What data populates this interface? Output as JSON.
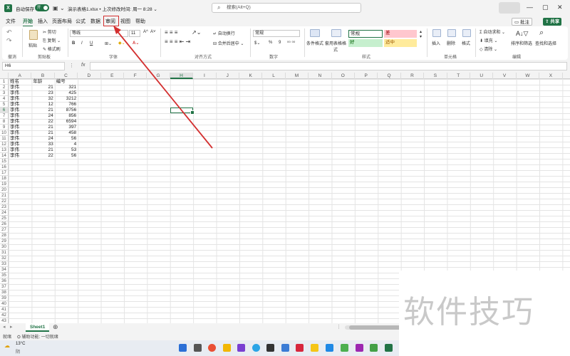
{
  "titlebar": {
    "autosave_label": "自动保存",
    "autosave_state": "开",
    "doc_title": "演示表格1.xlsx • 上次修改时间: 周一 8:28 ⌄",
    "search_placeholder": "搜索(Alt+Q)"
  },
  "menu": {
    "tabs": [
      "文件",
      "开始",
      "插入",
      "页面布局",
      "公式",
      "数据",
      "审阅",
      "视图",
      "帮助"
    ],
    "comment_btn": "批注",
    "share_btn": "共享"
  },
  "ribbon": {
    "undo": "撤消",
    "clipboard": {
      "paste": "粘贴",
      "cut": "剪切",
      "copy": "复制 ⌄",
      "format_painter": "格式刷",
      "label": "剪贴板"
    },
    "font": {
      "name": "等线",
      "size": "11",
      "grow": "A^",
      "shrink": "A˅",
      "bold": "B",
      "italic": "I",
      "underline": "U",
      "label": "字体"
    },
    "alignment": {
      "wrap": "自动换行",
      "merge": "合并后居中 ⌄",
      "label": "对齐方式"
    },
    "number": {
      "format": "常规",
      "pct": "%",
      "comma": "9",
      "label": "数字"
    },
    "styles": {
      "conditional": "条件格式",
      "table": "套用表格格式",
      "normal": "常规",
      "bad": "差",
      "good": "好",
      "neutral": "适中",
      "label": "样式"
    },
    "cells": {
      "insert": "插入",
      "delete": "删除",
      "format": "格式",
      "label": "单元格"
    },
    "editing": {
      "autosum": "自动求和 ⌄",
      "fill": "填充 ⌄",
      "clear": "清除 ⌄",
      "sort": "排序和筛选",
      "find": "查找和选择",
      "label": "编辑"
    }
  },
  "formula_bar": {
    "name_box": "H6",
    "fx": "fx",
    "value": ""
  },
  "columns": [
    "A",
    "B",
    "C",
    "D",
    "E",
    "F",
    "G",
    "H",
    "I",
    "J",
    "K",
    "L",
    "M",
    "N",
    "O",
    "P",
    "Q",
    "R",
    "S",
    "T",
    "U",
    "V",
    "W",
    "X"
  ],
  "selected": {
    "col": "H",
    "row": 6
  },
  "rows_visible": 43,
  "table": {
    "headers": [
      "姓名",
      "年龄",
      "编号"
    ],
    "rows": [
      [
        "李伟",
        "21",
        "321"
      ],
      [
        "李伟",
        "23",
        "425"
      ],
      [
        "李伟",
        "32",
        "3212"
      ],
      [
        "李伟",
        "12",
        "766"
      ],
      [
        "李伟",
        "21",
        "8756"
      ],
      [
        "李伟",
        "24",
        "856"
      ],
      [
        "李伟",
        "22",
        "6594"
      ],
      [
        "李伟",
        "21",
        "397"
      ],
      [
        "李伟",
        "21",
        "458"
      ],
      [
        "李伟",
        "24",
        "56"
      ],
      [
        "李伟",
        "33",
        "4"
      ],
      [
        "李伟",
        "21",
        "53"
      ],
      [
        "李伟",
        "22",
        "56"
      ]
    ]
  },
  "sheets": [
    "Sheet1"
  ],
  "status": {
    "ready": "就绪",
    "accessibility": "辅助功能: 一切就绪"
  },
  "taskbar": {
    "temp": "13°C",
    "weather": "阴"
  },
  "watermark": "软件技巧",
  "colors": {
    "accent": "#217346",
    "highlight": "#d32f2f"
  }
}
